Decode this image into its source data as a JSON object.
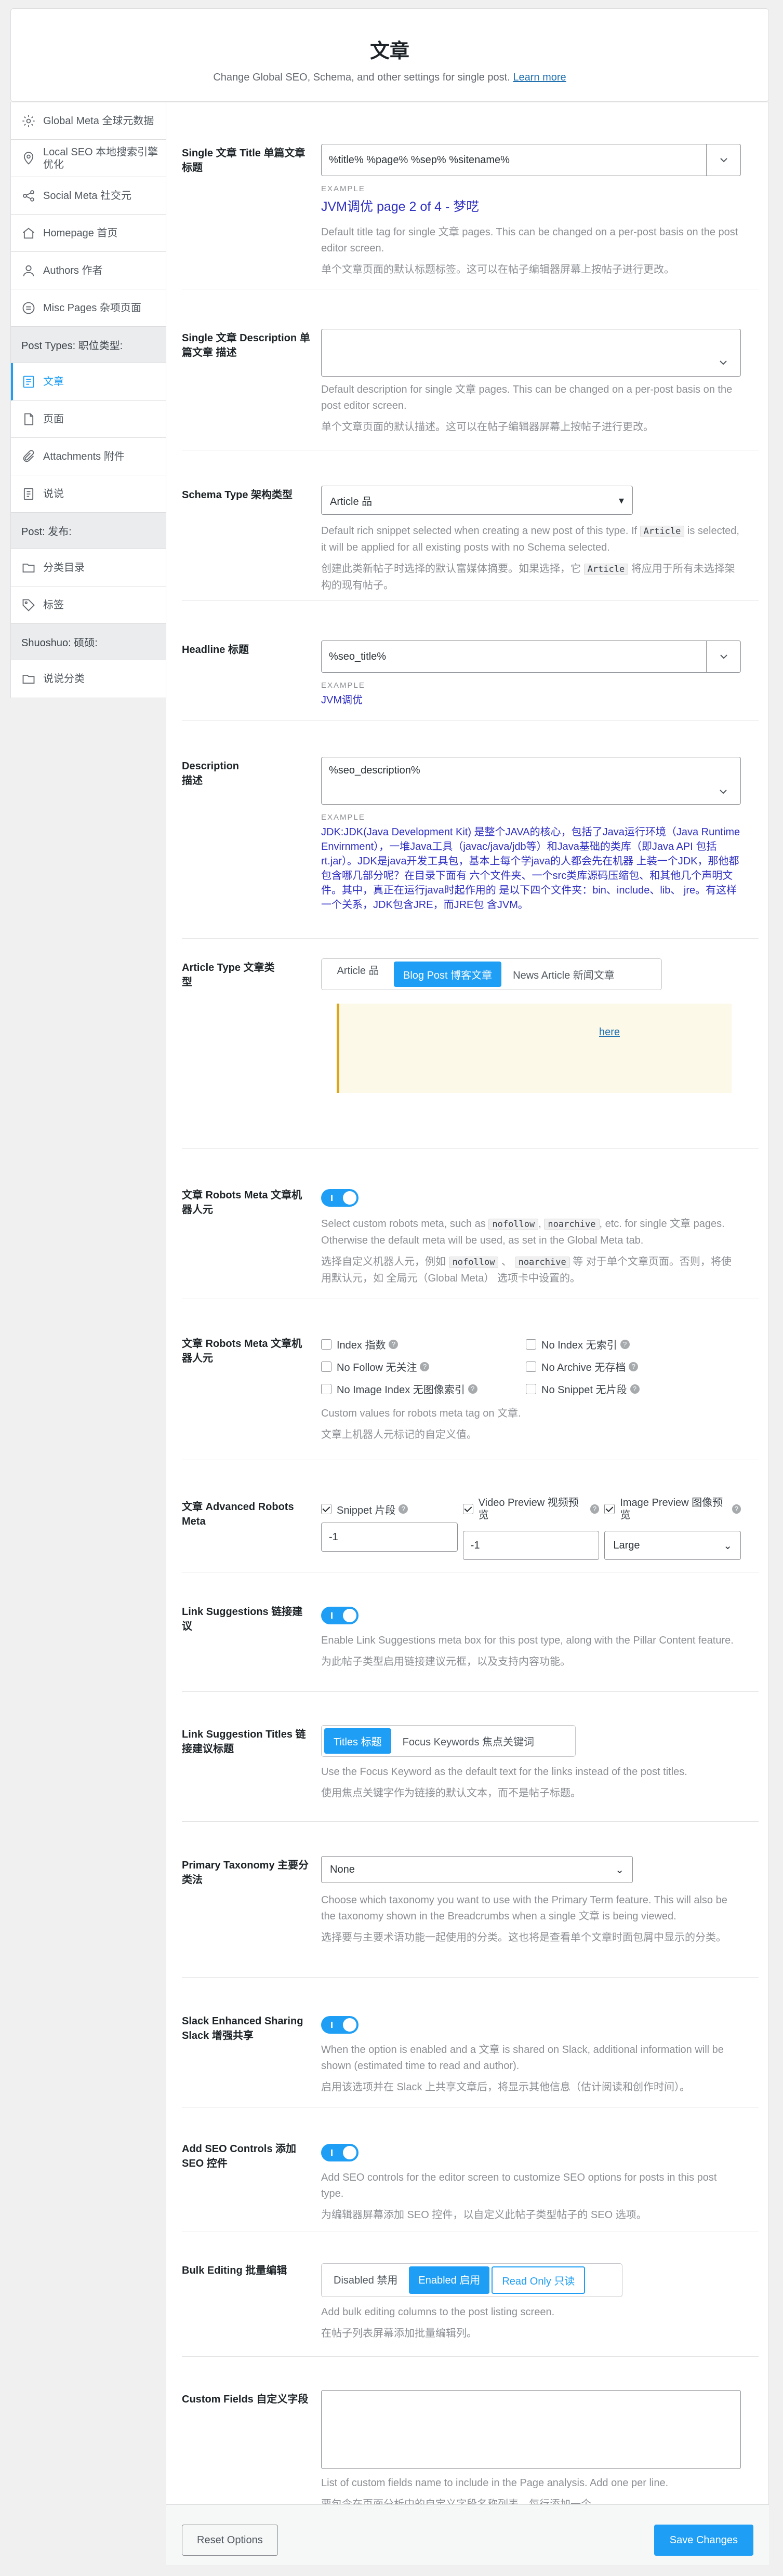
{
  "header": {
    "title": "文章",
    "subtitle": "Change Global SEO, Schema, and other settings for single post.",
    "learn_more": "Learn more"
  },
  "sidebar": {
    "items": [
      {
        "label": "Global Meta 全球元数据",
        "icon": "settings-icon"
      },
      {
        "label": "Local SEO 本地搜索引擎优化",
        "icon": "location-pin-icon"
      },
      {
        "label": "Social Meta 社交元",
        "icon": "social-network-icon"
      },
      {
        "label": "Homepage 首页",
        "icon": "home-icon"
      },
      {
        "label": "Authors 作者",
        "icon": "user-icon"
      },
      {
        "label": "Misc Pages 杂项页面",
        "icon": "misc-pages-icon"
      }
    ],
    "section_post_types": "Post Types: 职位类型:",
    "post_types": [
      {
        "label": "文章",
        "icon": "post-icon",
        "active": true
      },
      {
        "label": "页面",
        "icon": "page-icon"
      },
      {
        "label": "Attachments 附件",
        "icon": "attachment-icon"
      },
      {
        "label": "说说",
        "icon": "document-icon"
      }
    ],
    "section_post": "Post: 发布:",
    "post": [
      {
        "label": "分类目录",
        "icon": "folder-icon"
      },
      {
        "label": "标签",
        "icon": "tag-icon"
      }
    ],
    "section_shuoshuo": "Shuoshuo: 硕硕:",
    "shuoshuo": [
      {
        "label": "说说分类",
        "icon": "folder-icon"
      }
    ]
  },
  "fields": {
    "title": {
      "label": "Single 文章 Title 单篇文章标题",
      "value": "%title% %page% %sep% %sitename%",
      "example_label": "EXAMPLE",
      "example": "JVM调优 page 2 of 4 - 梦呓",
      "desc": "Default title tag for single 文章 pages. This can be changed on a per-post basis on the post editor screen.",
      "desc_cn": "单个文章页面的默认标题标签。这可以在帖子编辑器屏幕上按帖子进行更改。"
    },
    "description": {
      "label": "Single 文章 Description 单篇文章 描述",
      "value": "",
      "desc": "Default description for single 文章 pages. This can be changed on a per-post basis on the post editor screen.",
      "desc_cn": "单个文章页面的默认描述。这可以在帖子编辑器屏幕上按帖子进行更改。"
    },
    "schema": {
      "label": "Schema Type 架构类型",
      "value": "Article 品",
      "desc_a": "Default rich snippet selected when creating a new post of this type. If ",
      "desc_code": "Article",
      "desc_b": " is selected, it will be applied for all existing posts with no Schema selected.",
      "desc_cn_a": "创建此类新帖子时选择的默认富媒体摘要。如果选择，它 ",
      "desc_cn_code": "Article",
      "desc_cn_b": " 将应用于所有未选择架构的现有帖子。"
    },
    "headline": {
      "label": "Headline 标题",
      "value": "%seo_title%",
      "example_label": "EXAMPLE",
      "example": "JVM调优"
    },
    "desc_field": {
      "label": "Description 描述",
      "value": "%seo_description%",
      "example_label": "EXAMPLE",
      "example": "JDK:JDK(Java Development Kit) 是整个JAVA的核心，包括了Java运行环境（Java Runtime Envirnment），一堆Java工具（javac/java/jdb等）和Java基础的类库（即Java API 包括rt.jar）。JDK是java开发工具包，基本上每个学java的人都会先在机器 上装一个JDK，那他都包含哪几部分呢？在目录下面有 六个文件夹、一个src类库源码压缩包、和其他几个声明文件。其中，真正在运行java时起作用的 是以下四个文件夹：bin、include、lib、 jre。有这样一个关系，JDK包含JRE，而JRE包 含JVM。"
    },
    "article_type": {
      "label": "Article Type 文章类型",
      "options": [
        "Article 品",
        "Blog Post 博客文章",
        "News Article 新闻文章"
      ],
      "selected": 1,
      "notice_link": "here"
    },
    "robots_meta": {
      "label": "文章 Robots Meta 文章机器人元",
      "desc_a": "Select custom robots meta, such as ",
      "code1": "nofollow",
      "desc_sep": ", ",
      "code2": "noarchive",
      "desc_b": ", etc. for single 文章 pages. Otherwise the default meta will be used, as set in the Global Meta tab.",
      "desc_cn_a": "选择自定义机器人元，例如 ",
      "desc_cn_sep": " 、 ",
      "desc_cn_b": " 等 对于单个文章页面。否则，将使用默认元，如 全局元（Global Meta） 选项卡中设置的。"
    },
    "robots_meta2": {
      "label": "文章 Robots Meta 文章机器人元",
      "checks": [
        {
          "label": "Index 指数",
          "on": false
        },
        {
          "label": "No Index 无索引",
          "on": false
        },
        {
          "label": "No Follow 无关注",
          "on": false
        },
        {
          "label": "No Archive 无存档",
          "on": false
        },
        {
          "label": "No Image Index 无图像索引",
          "on": false
        },
        {
          "label": "No Snippet 无片段",
          "on": false
        }
      ],
      "desc": "Custom values for robots meta tag on 文章.",
      "desc_cn": "文章上机器人元标记的自定义值。"
    },
    "advanced": {
      "label": "文章 Advanced Robots Meta",
      "snippet_label": "Snippet 片段",
      "snippet_value": "-1",
      "video_label": "Video Preview 视频预览",
      "video_value": "-1",
      "image_label": "Image Preview 图像预览",
      "image_value": "Large"
    },
    "link_suggestions": {
      "label": "Link Suggestions 链接建议",
      "desc": "Enable Link Suggestions meta box for this post type, along with the Pillar Content feature.",
      "desc_cn": "为此帖子类型启用链接建议元框，以及支持内容功能。"
    },
    "link_titles": {
      "label": "Link Suggestion Titles 链接建议标题",
      "options": [
        "Titles 标题",
        "Focus Keywords 焦点关键词"
      ],
      "desc": "Use the Focus Keyword as the default text for the links instead of the post titles.",
      "desc_cn": "使用焦点关键字作为链接的默认文本，而不是帖子标题。"
    },
    "primary_tax": {
      "label": "Primary Taxonomy 主要分类法",
      "value": "None",
      "desc": "Choose which taxonomy you want to use with the Primary Term feature. This will also be the taxonomy shown in the Breadcrumbs when a single 文章 is being viewed.",
      "desc_cn": "选择要与主要术语功能一起使用的分类。这也将是查看单个文章时面包屑中显示的分类。"
    },
    "slack": {
      "label": "Slack Enhanced Sharing Slack 增强共享",
      "desc": "When the option is enabled and a 文章 is shared on Slack, additional information will be shown (estimated time to read and author).",
      "desc_cn": "启用该选项并在 Slack 上共享文章后，将显示其他信息（估计阅读和创作时间）。"
    },
    "seo_controls": {
      "label": "Add SEO Controls 添加 SEO 控件",
      "desc": "Add SEO controls for the editor screen to customize SEO options for posts in this post type.",
      "desc_cn": "为编辑器屏幕添加 SEO 控件，以自定义此帖子类型帖子的 SEO 选项。"
    },
    "bulk": {
      "label": "Bulk Editing 批量编辑",
      "options": [
        "Disabled 禁用",
        "Enabled 启用",
        "Read Only 只读"
      ],
      "desc": "Add bulk editing columns to the post listing screen.",
      "desc_cn": "在帖子列表屏幕添加批量编辑列。"
    },
    "custom_fields": {
      "label": "Custom Fields 自定义字段",
      "value": "",
      "desc": "List of custom fields name to include in the Page analysis. Add one per line.",
      "desc_cn": "要包含在页面分析中的自定义字段名称列表。每行添加一个。"
    }
  },
  "footer": {
    "reset": "Reset Options",
    "save": "Save Changes"
  },
  "colors": {
    "accent": "#1e9ef5",
    "example_text": "#2f2fc3",
    "notice_border": "#dba617"
  }
}
